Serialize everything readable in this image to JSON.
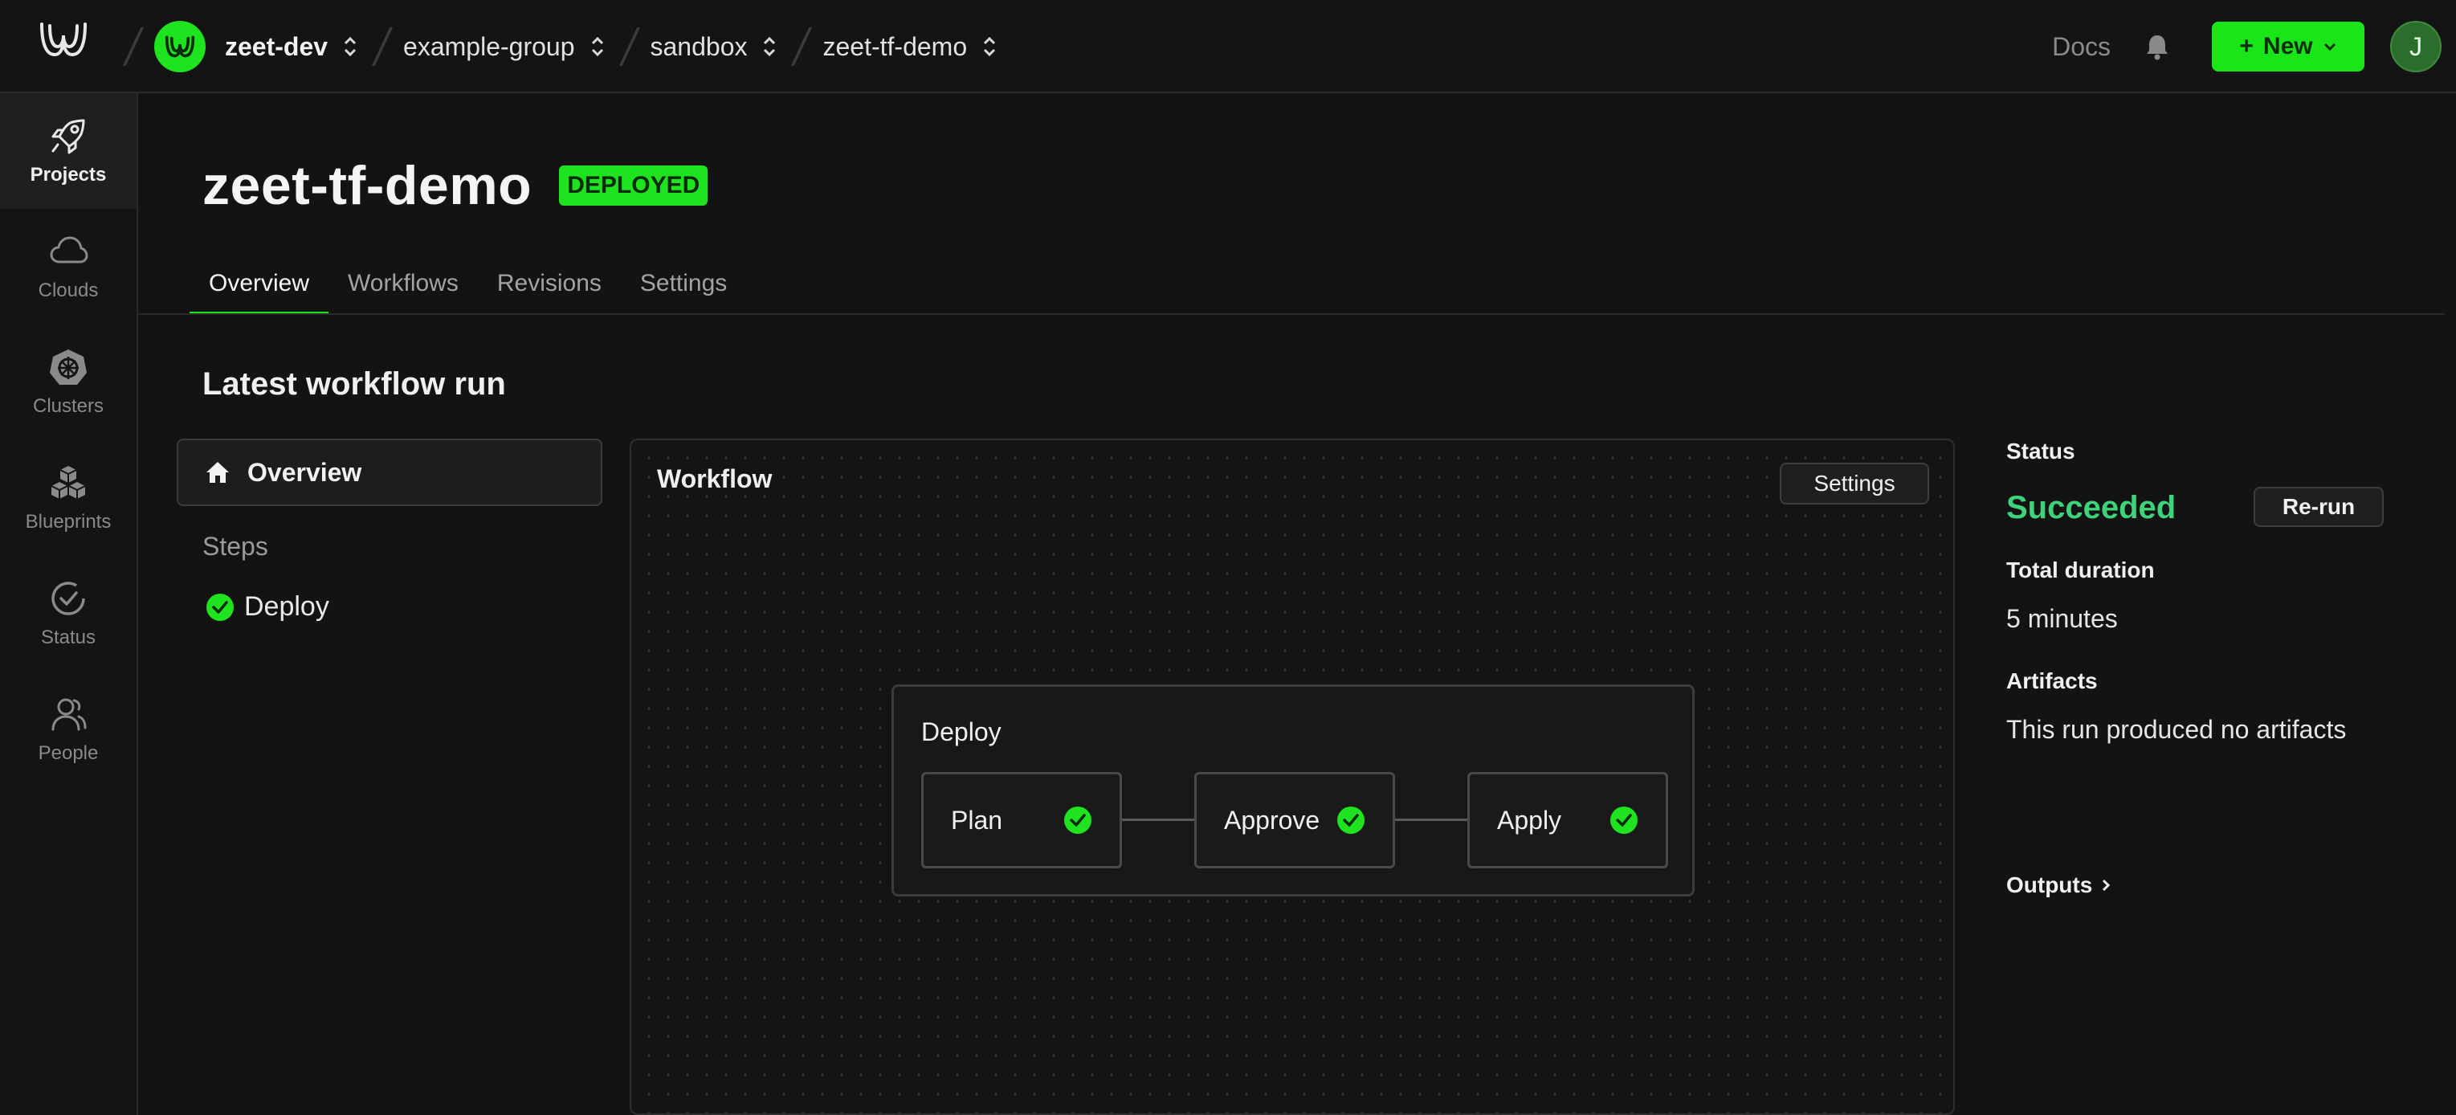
{
  "header": {
    "breadcrumbs": [
      {
        "label": "zeet-dev"
      },
      {
        "label": "example-group"
      },
      {
        "label": "sandbox"
      },
      {
        "label": "zeet-tf-demo"
      }
    ],
    "docs_label": "Docs",
    "new_button_label": "New",
    "user_initial": "J"
  },
  "sidebar": {
    "items": [
      {
        "label": "Projects",
        "icon": "rocket-icon",
        "active": true
      },
      {
        "label": "Clouds",
        "icon": "cloud-icon"
      },
      {
        "label": "Clusters",
        "icon": "helm-icon"
      },
      {
        "label": "Blueprints",
        "icon": "cubes-icon"
      },
      {
        "label": "Status",
        "icon": "status-check-icon"
      },
      {
        "label": "People",
        "icon": "people-icon"
      }
    ]
  },
  "project": {
    "title": "zeet-tf-demo",
    "status_badge": "DEPLOYED"
  },
  "tabs": [
    {
      "label": "Overview",
      "active": true
    },
    {
      "label": "Workflows"
    },
    {
      "label": "Revisions"
    },
    {
      "label": "Settings"
    }
  ],
  "run": {
    "section_title": "Latest workflow run",
    "overview_label": "Overview",
    "steps_label": "Steps",
    "steps": [
      {
        "label": "Deploy",
        "status": "success"
      }
    ]
  },
  "workflow": {
    "title": "Workflow",
    "settings_label": "Settings",
    "group_title": "Deploy",
    "nodes": [
      {
        "label": "Plan",
        "status": "success"
      },
      {
        "label": "Approve",
        "status": "success"
      },
      {
        "label": "Apply",
        "status": "success"
      }
    ]
  },
  "summary": {
    "status_label": "Status",
    "status_value": "Succeeded",
    "rerun_label": "Re-run",
    "duration_label": "Total duration",
    "duration_value": "5 minutes",
    "artifacts_label": "Artifacts",
    "artifacts_value": "This run produced no artifacts",
    "outputs_label": "Outputs"
  },
  "colors": {
    "accent": "#1ee31e",
    "success_text": "#3ed27a",
    "background": "#131313"
  }
}
